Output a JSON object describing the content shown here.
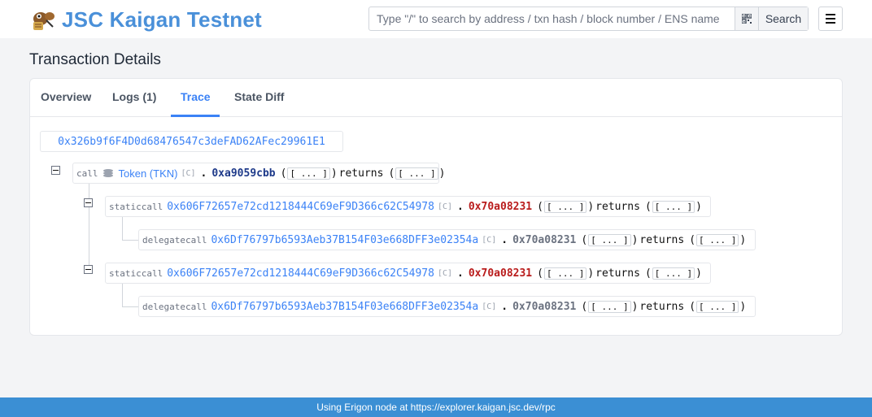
{
  "header": {
    "title": "JSC Kaigan Testnet",
    "logo_icon": "kaigan-logo-icon",
    "search": {
      "placeholder": "Type \"/\" to search by address / txn hash / block number / ENS name",
      "value": "",
      "button_label": "Search",
      "qr_icon": "qr-code-icon"
    },
    "menu_icon": "hamburger-menu-icon"
  },
  "page": {
    "title": "Transaction Details"
  },
  "tabs": [
    {
      "label": "Overview",
      "active": false
    },
    {
      "label": "Logs (1)",
      "active": true
    },
    {
      "label": "Trace",
      "active": true
    },
    {
      "label": "State Diff",
      "active": false
    }
  ],
  "trace": {
    "root_address": "0x326b9f6F4D0d68476547c3deFAD62AFec29961E1",
    "nodes": [
      {
        "kind": "call",
        "token_label": "Token (TKN)",
        "contract_flag": "[C]",
        "dot": ".",
        "selector": "0xa9059cbb",
        "args_open": "(",
        "args": "[ ... ]",
        "args_close": ")",
        "returns_label": "returns",
        "returns_open": "(",
        "returns": "[ ... ]",
        "returns_close": ")"
      },
      {
        "kind": "staticcall",
        "address": "0x606F72657e72cd1218444C69eF9D366c62C54978",
        "contract_flag": "[C]",
        "dot": ".",
        "selector": "0x70a08231",
        "args_open": "(",
        "args": "[ ... ]",
        "args_close": ")",
        "returns_label": "returns",
        "returns_open": "(",
        "returns": "[ ... ]",
        "returns_close": ")"
      },
      {
        "kind": "delegatecall",
        "address": "0x6Df76797b6593Aeb37B154F03e668DFF3e02354a",
        "contract_flag": "[C]",
        "dot": ".",
        "selector": "0x70a08231",
        "args_open": "(",
        "args": "[ ... ]",
        "args_close": ")",
        "returns_label": "returns",
        "returns_open": "(",
        "returns": "[ ... ]",
        "returns_close": ")"
      },
      {
        "kind": "staticcall",
        "address": "0x606F72657e72cd1218444C69eF9D366c62C54978",
        "contract_flag": "[C]",
        "dot": ".",
        "selector": "0x70a08231",
        "args_open": "(",
        "args": "[ ... ]",
        "args_close": ")",
        "returns_label": "returns",
        "returns_open": "(",
        "returns": "[ ... ]",
        "returns_close": ")"
      },
      {
        "kind": "delegatecall",
        "address": "0x6Df76797b6593Aeb37B154F03e668DFF3e02354a",
        "contract_flag": "[C]",
        "dot": ".",
        "selector": "0x70a08231",
        "args_open": "(",
        "args": "[ ... ]",
        "args_close": ")",
        "returns_label": "returns",
        "returns_open": "(",
        "returns": "[ ... ]",
        "returns_close": ")"
      }
    ]
  },
  "footer": {
    "text": "Using Erigon node at https://explorer.kaigan.jsc.dev/rpc"
  },
  "colors": {
    "brand": "#4a90d9",
    "accent": "#3b82f6",
    "selector_navy": "#1e3a8a",
    "selector_red": "#b91c1c",
    "footer_bg": "#3b8fd4"
  }
}
